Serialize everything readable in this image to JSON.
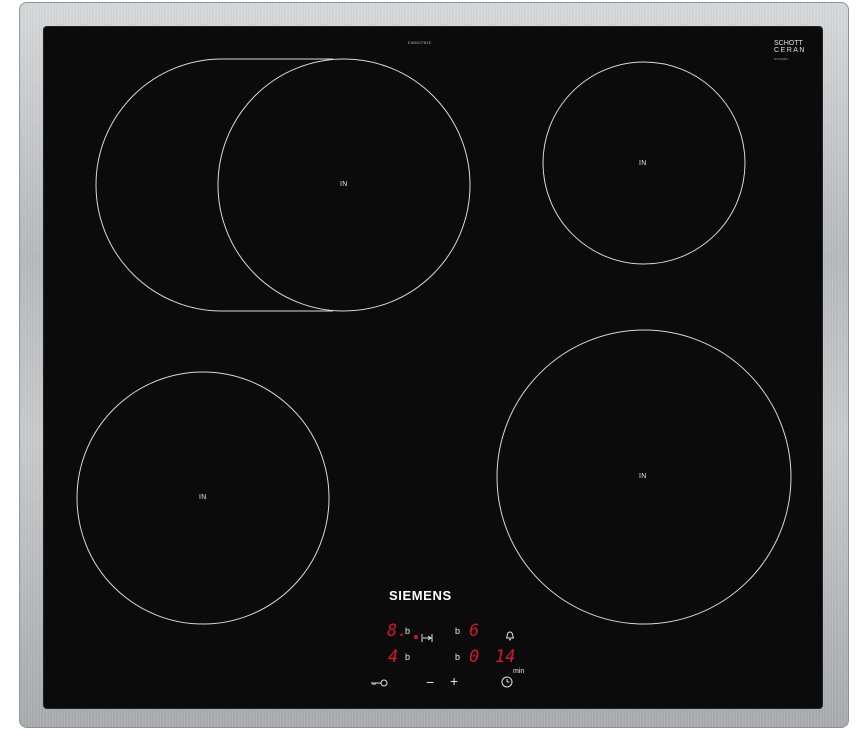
{
  "model": "EI645CFB1E",
  "cert": {
    "brand_top": "SCHOTT",
    "brand_bottom": "CERAN",
    "code": "N07209B1"
  },
  "brand": "SIEMENS",
  "zones": [
    {
      "id": "rear-left",
      "label": "IN"
    },
    {
      "id": "rear-right",
      "label": "IN"
    },
    {
      "id": "front-left",
      "label": "IN"
    },
    {
      "id": "front-right",
      "label": "IN"
    }
  ],
  "display": {
    "left_top_level": "8.",
    "left_top_b": "b",
    "left_bottom_level": "4",
    "left_bottom_b": "b",
    "right_top_b": "b",
    "right_top_level": "6",
    "right_bottom_b": "b",
    "right_bottom_level": "0",
    "timer_value": "14",
    "timer_unit": "min"
  },
  "controls": {
    "minus": "−",
    "plus": "+"
  },
  "icons": [
    "key-lock-icon",
    "bell-icon",
    "clock-icon",
    "bridge-icon"
  ],
  "colors": {
    "display_red": "#d2192a",
    "glass": "#0b0b0b",
    "frame": "#b7babd"
  }
}
